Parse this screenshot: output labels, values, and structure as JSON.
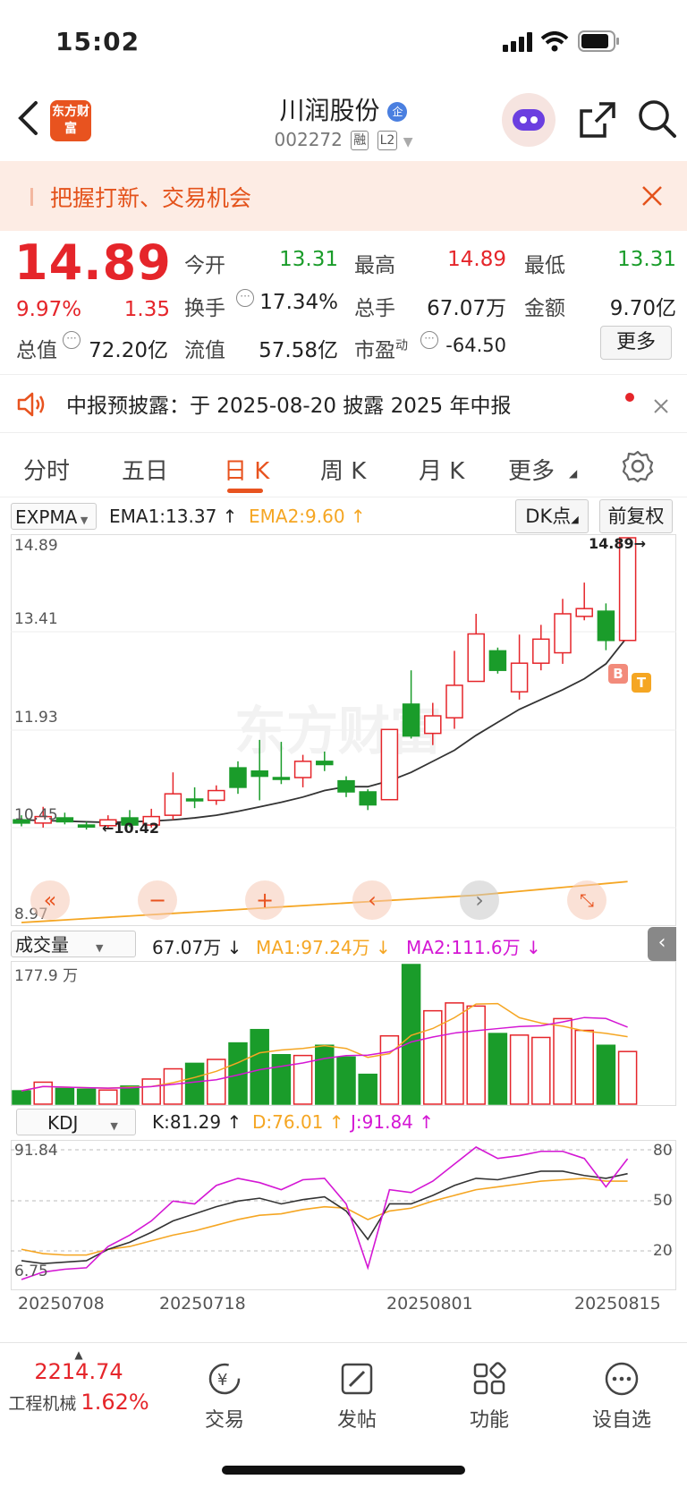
{
  "status_bar": {
    "time": "15:02"
  },
  "header": {
    "logo_text": "东方财富",
    "title": "川润股份",
    "badge": "企",
    "code": "002272",
    "tags": [
      "融",
      "L2"
    ]
  },
  "banner": {
    "text": "把握打新、交易机会"
  },
  "quote": {
    "price": "14.89",
    "change_pct": "9.97%",
    "change": "1.35",
    "stats": [
      {
        "label": "今开",
        "value": "13.31",
        "color": "green"
      },
      {
        "label": "最高",
        "value": "14.89",
        "color": "red"
      },
      {
        "label": "最低",
        "value": "13.31",
        "color": "green"
      },
      {
        "label": "换手",
        "value": "17.34%",
        "color": "dark"
      },
      {
        "label": "总手",
        "value": "67.07万",
        "color": "dark"
      },
      {
        "label": "金额",
        "value": "9.70亿",
        "color": "dark"
      },
      {
        "label": "总值",
        "value": "72.20亿",
        "color": "dark"
      },
      {
        "label": "流值",
        "value": "57.58亿",
        "color": "dark"
      },
      {
        "label": "市盈",
        "value": "-64.50",
        "color": "dark"
      }
    ],
    "pe_suffix": "动",
    "more_button": "更多"
  },
  "notice": {
    "text": "中报预披露：于 2025-08-20 披露 2025 年中报"
  },
  "tabs": [
    {
      "label": "分时",
      "active": false
    },
    {
      "label": "五日",
      "active": false
    },
    {
      "label": "日 K",
      "active": true
    },
    {
      "label": "周 K",
      "active": false
    },
    {
      "label": "月 K",
      "active": false
    },
    {
      "label": "更多",
      "active": false
    }
  ],
  "kline": {
    "indicator": "EXPMA",
    "ema1": "EMA1:13.37",
    "ema2": "EMA2:9.60",
    "dk_button": "DK点",
    "adjust_button": "前复权",
    "y_labels": [
      "14.89",
      "13.41",
      "11.93",
      "10.45",
      "8.97"
    ],
    "max_label": "14.89",
    "min_label": "10.42",
    "marker_b": "B",
    "marker_t": "T"
  },
  "volume": {
    "indicator": "成交量",
    "value": "67.07万",
    "ma1": "MA1:97.24万",
    "ma2": "MA2:111.6万",
    "y_top": "177.9 万"
  },
  "kdj": {
    "indicator": "KDJ",
    "k": "K:81.29",
    "d": "D:76.01",
    "j": "J:91.84",
    "y_top": "91.84",
    "y_bottom": "6.75",
    "levels": [
      "80",
      "50",
      "20"
    ]
  },
  "x_dates": [
    "20250708",
    "20250718",
    "20250801",
    "20250815"
  ],
  "chart_data": {
    "type": "candlestick",
    "series": [
      {
        "open": 10.55,
        "close": 10.5,
        "high": 10.62,
        "low": 10.45
      },
      {
        "open": 10.5,
        "close": 10.6,
        "high": 10.75,
        "low": 10.43
      },
      {
        "open": 10.58,
        "close": 10.52,
        "high": 10.66,
        "low": 10.48
      },
      {
        "open": 10.47,
        "close": 10.44,
        "high": 10.52,
        "low": 10.4
      },
      {
        "open": 10.46,
        "close": 10.55,
        "high": 10.62,
        "low": 10.42
      },
      {
        "open": 10.58,
        "close": 10.47,
        "high": 10.7,
        "low": 10.44
      },
      {
        "open": 10.47,
        "close": 10.6,
        "high": 10.72,
        "low": 10.43
      },
      {
        "open": 10.62,
        "close": 10.95,
        "high": 11.28,
        "low": 10.55
      },
      {
        "open": 10.87,
        "close": 10.85,
        "high": 11.05,
        "low": 10.73
      },
      {
        "open": 10.85,
        "close": 11.0,
        "high": 11.08,
        "low": 10.78
      },
      {
        "open": 11.35,
        "close": 11.05,
        "high": 11.45,
        "low": 10.95
      },
      {
        "open": 11.3,
        "close": 11.22,
        "high": 11.78,
        "low": 10.85
      },
      {
        "open": 11.2,
        "close": 11.18,
        "high": 11.75,
        "low": 11.1
      },
      {
        "open": 11.2,
        "close": 11.45,
        "high": 11.55,
        "low": 11.05
      },
      {
        "open": 11.45,
        "close": 11.4,
        "high": 11.6,
        "low": 11.3
      },
      {
        "open": 11.15,
        "close": 10.98,
        "high": 11.22,
        "low": 10.9
      },
      {
        "open": 10.98,
        "close": 10.78,
        "high": 11.02,
        "low": 10.7
      },
      {
        "open": 10.86,
        "close": 11.94,
        "high": 11.94,
        "low": 10.86
      },
      {
        "open": 12.33,
        "close": 11.84,
        "high": 12.85,
        "low": 11.8
      },
      {
        "open": 11.88,
        "close": 12.15,
        "high": 12.35,
        "low": 11.7
      },
      {
        "open": 12.12,
        "close": 12.62,
        "high": 13.15,
        "low": 11.95
      },
      {
        "open": 12.68,
        "close": 13.41,
        "high": 13.72,
        "low": 12.68
      },
      {
        "open": 13.15,
        "close": 12.85,
        "high": 13.2,
        "low": 12.8
      },
      {
        "open": 12.52,
        "close": 12.96,
        "high": 13.4,
        "low": 12.4
      },
      {
        "open": 12.96,
        "close": 13.33,
        "high": 13.55,
        "low": 12.85
      },
      {
        "open": 13.12,
        "close": 13.72,
        "high": 13.95,
        "low": 12.95
      },
      {
        "open": 13.68,
        "close": 13.8,
        "high": 14.2,
        "low": 13.62
      },
      {
        "open": 13.76,
        "close": 13.31,
        "high": 13.88,
        "low": 13.16
      },
      {
        "open": 13.31,
        "close": 14.89,
        "high": 14.89,
        "low": 13.31
      }
    ],
    "ema1": [
      10.55,
      10.54,
      10.53,
      10.52,
      10.51,
      10.52,
      10.53,
      10.55,
      10.58,
      10.62,
      10.68,
      10.75,
      10.82,
      10.9,
      11.0,
      11.06,
      11.06,
      11.15,
      11.28,
      11.45,
      11.62,
      11.85,
      12.05,
      12.25,
      12.4,
      12.55,
      12.72,
      12.95,
      13.37
    ],
    "ema2": [
      8.97,
      8.99,
      9.01,
      9.03,
      9.05,
      9.07,
      9.09,
      9.11,
      9.13,
      9.15,
      9.17,
      9.19,
      9.21,
      9.23,
      9.25,
      9.27,
      9.29,
      9.31,
      9.33,
      9.35,
      9.37,
      9.39,
      9.42,
      9.45,
      9.48,
      9.51,
      9.54,
      9.57,
      9.6
    ],
    "volume": [
      17,
      28,
      20,
      19,
      18,
      23,
      32,
      45,
      52,
      57,
      78,
      95,
      63,
      62,
      75,
      60,
      38,
      87,
      177.9,
      119,
      129,
      125,
      90,
      88,
      85,
      109,
      94,
      75,
      67.07
    ],
    "kdj_k": [
      20,
      18,
      19,
      20,
      28,
      33,
      40,
      48,
      53,
      58,
      62,
      64,
      60,
      63,
      65,
      55,
      35,
      60,
      60,
      66,
      73,
      78,
      77,
      80,
      83,
      83,
      80,
      78,
      81.29
    ],
    "kdj_d": [
      28,
      25,
      24,
      24,
      28,
      30,
      34,
      38,
      41,
      45,
      49,
      52,
      53,
      56,
      58,
      57,
      49,
      55,
      57,
      62,
      66,
      70,
      72,
      74,
      76,
      77,
      78,
      76,
      76.01
    ],
    "kdj_j": [
      6.75,
      12,
      14,
      15,
      30,
      38,
      48,
      62,
      60,
      73,
      78,
      75,
      70,
      77,
      78,
      60,
      15,
      70,
      68,
      76,
      88,
      100,
      92,
      94,
      97,
      97,
      92,
      72,
      91.84
    ]
  },
  "bottom_bar": {
    "index_value": "2214.74",
    "index_name": "工程机械",
    "index_change": "1.62%",
    "items": [
      "交易",
      "发帖",
      "功能",
      "设自选"
    ]
  },
  "colors": {
    "up": "#e5252a",
    "down": "#1a9c2a",
    "accent": "#e8531f",
    "ema2": "#f5a623",
    "j": "#d417d4"
  }
}
